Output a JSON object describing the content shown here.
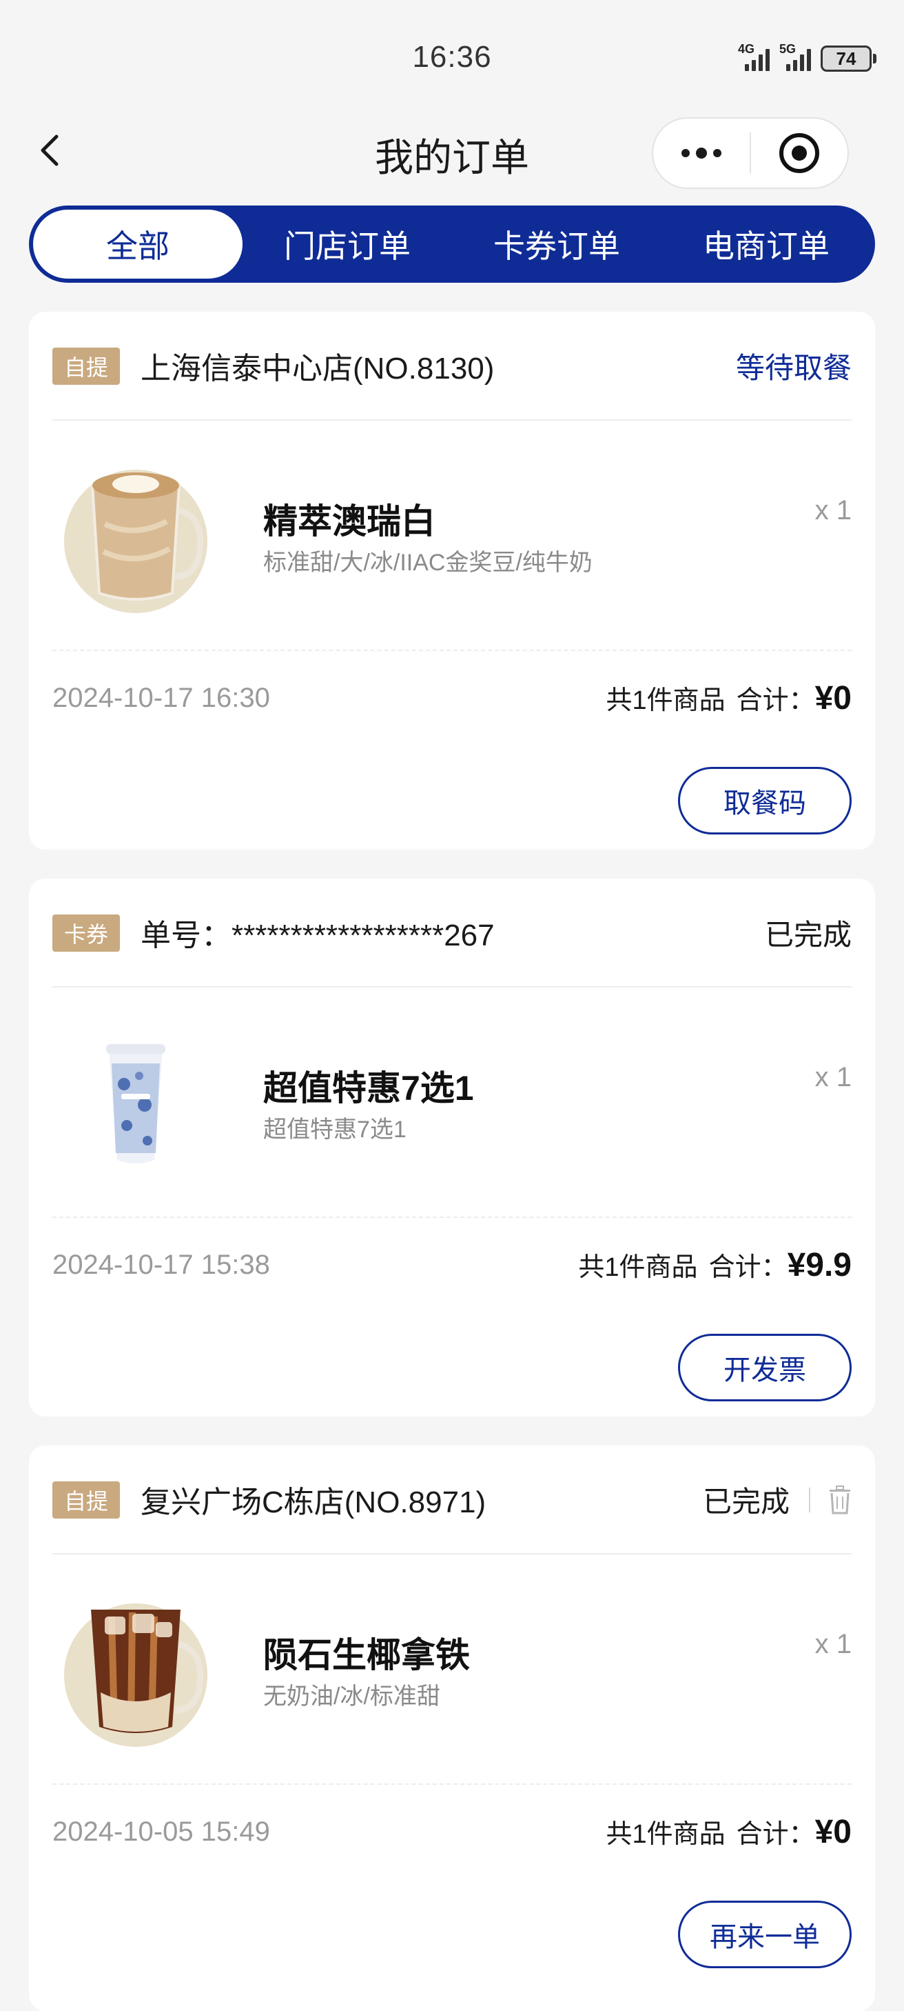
{
  "status_bar": {
    "time": "16:36",
    "network_1": "4G",
    "network_2": "5G",
    "battery": "74"
  },
  "navbar": {
    "title": "我的订单",
    "icons": [
      "back-icon",
      "more-dots-icon",
      "target-icon"
    ]
  },
  "tabs": [
    {
      "label": "全部",
      "active": true
    },
    {
      "label": "门店订单",
      "active": false
    },
    {
      "label": "卡券订单",
      "active": false
    },
    {
      "label": "电商订单",
      "active": false
    }
  ],
  "orders": [
    {
      "badge": "自提",
      "store": "上海信泰中心店(NO.8130)",
      "status": "等待取餐",
      "item_name": "精萃澳瑞白",
      "item_spec": "标准甜/大/冰/IIAC金奖豆/纯牛奶",
      "qty": "x 1",
      "date": "2024-10-17 16:30",
      "count_text": "共1件商品",
      "total_label": "合计：",
      "price": "¥0",
      "button": "取餐码"
    },
    {
      "badge": "卡券",
      "store": "单号：******************267",
      "status": "已完成",
      "item_name": "超值特惠7选1",
      "item_spec": "超值特惠7选1",
      "qty": "x 1",
      "date": "2024-10-17 15:38",
      "count_text": "共1件商品",
      "total_label": "合计：",
      "price": "¥9.9",
      "button": "开发票"
    },
    {
      "badge": "自提",
      "store": "复兴广场C栋店(NO.8971)",
      "status": "已完成",
      "item_name": "陨石生椰拿铁",
      "item_spec": "无奶油/冰/标准甜",
      "qty": "x 1",
      "date": "2024-10-05 15:49",
      "count_text": "共1件商品",
      "total_label": "合计：",
      "price": "¥0",
      "button": "再来一单"
    }
  ],
  "colors": {
    "brand_blue": "#0f2c96",
    "badge_tan": "#c9a97f",
    "background": "#f5f5f5"
  }
}
